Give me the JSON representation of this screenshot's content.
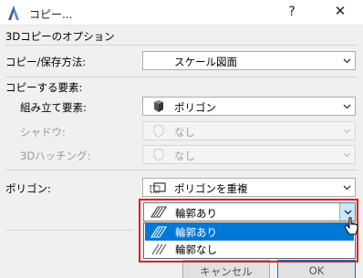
{
  "window": {
    "title": "コピー...",
    "help_label": "?",
    "close_label": "✕"
  },
  "section_options": "3Dコピーのオプション",
  "copy_save_method": {
    "label": "コピー/保存方法:",
    "value": "スケール図面"
  },
  "section_elements": "コピーする要素:",
  "build_elements": {
    "label": "組み立て要素:",
    "value": "ポリゴン"
  },
  "shadow": {
    "label": "シャドウ:",
    "value": "なし"
  },
  "hatching": {
    "label": "3Dハッチング:",
    "value": "なし"
  },
  "polygon": {
    "label": "ポリゴン:",
    "value": "ポリゴンを重複"
  },
  "outline_combo": {
    "value": "輪郭あり"
  },
  "outline_options": [
    "輪郭あり",
    "輪郭なし"
  ],
  "buttons": {
    "cancel": "キャンセル",
    "ok": "OK"
  },
  "colors": {
    "selection": "#0078d7",
    "highlight_frame": "#e02020"
  }
}
